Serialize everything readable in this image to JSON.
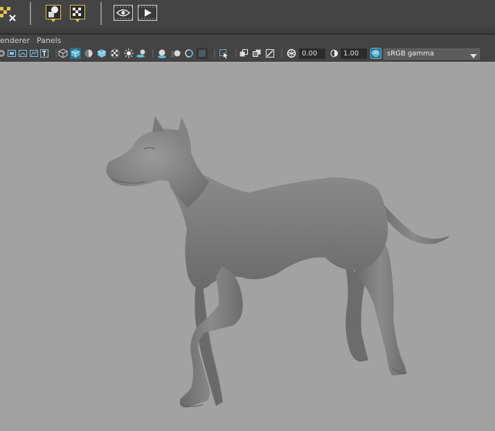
{
  "menubar": {
    "items": [
      "enderer",
      "Panels"
    ]
  },
  "toolbar": {
    "exposure_value": "0.00",
    "gamma_value": "1.00",
    "colormanage_badge": "ON",
    "view_transform": "sRGB gamma"
  },
  "colors": {
    "panel_bg": "#444444",
    "viewport_bg": "#a2a2a2",
    "accent_active": "#5fb6d8",
    "shelf_yellow": "#e2c74d"
  },
  "viewport": {
    "content": "grey-shaded dog model"
  }
}
